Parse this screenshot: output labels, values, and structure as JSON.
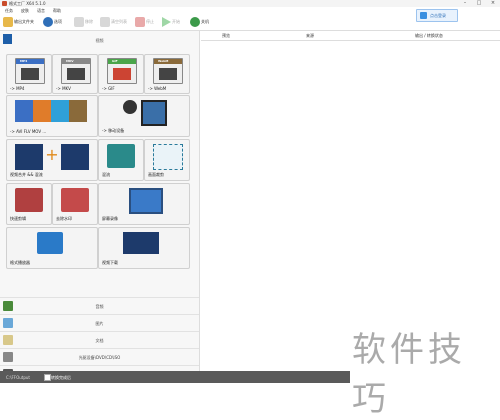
{
  "window": {
    "title": "格式工厂 X64 5.1.0"
  },
  "menu": [
    "任务",
    "皮肤",
    "语言",
    "帮助"
  ],
  "toolbar": {
    "output_folder": "输出文件夹",
    "options": "选项",
    "remove": "移除",
    "clear_list": "清空列表",
    "stop": "停止",
    "start": "开始",
    "login": "点击登录"
  },
  "left": {
    "video_header": "视频",
    "cards": {
      "mp4": "-> MP4",
      "mkv": "-> MKV",
      "gif": "-> GIF",
      "webm": "-> WebM",
      "multi": "-> AVI FLV MOV ...",
      "mobile": "-> 移动设备",
      "merge": "视频合并 && 混流",
      "clip": "混流",
      "crop": "画面裁剪",
      "fastclip": "快速剪辑",
      "watermark": "去除水印",
      "screenrec": "屏幕录像",
      "player": "格式播放器",
      "download": "视频下载"
    },
    "format_tags": {
      "mp4": "MP4",
      "mkv": "MKV",
      "gif": "GIF",
      "webm": "WebM"
    },
    "categories": {
      "audio": "音频",
      "image": "图片",
      "document": "文档",
      "disc": "光驱设备\\DVD\\CD\\ISO",
      "tools": "工具集"
    }
  },
  "list": {
    "col_preview": "预览",
    "col_source": "来源",
    "col_output": "输出 / 转换状态"
  },
  "status": {
    "path": "C:\\FFOutput",
    "shutdown_label": "转换完成后"
  },
  "watermark_text": "软件技巧",
  "colors": {
    "accent": "#3a8fe0",
    "statusbar": "#5a5a5a"
  }
}
